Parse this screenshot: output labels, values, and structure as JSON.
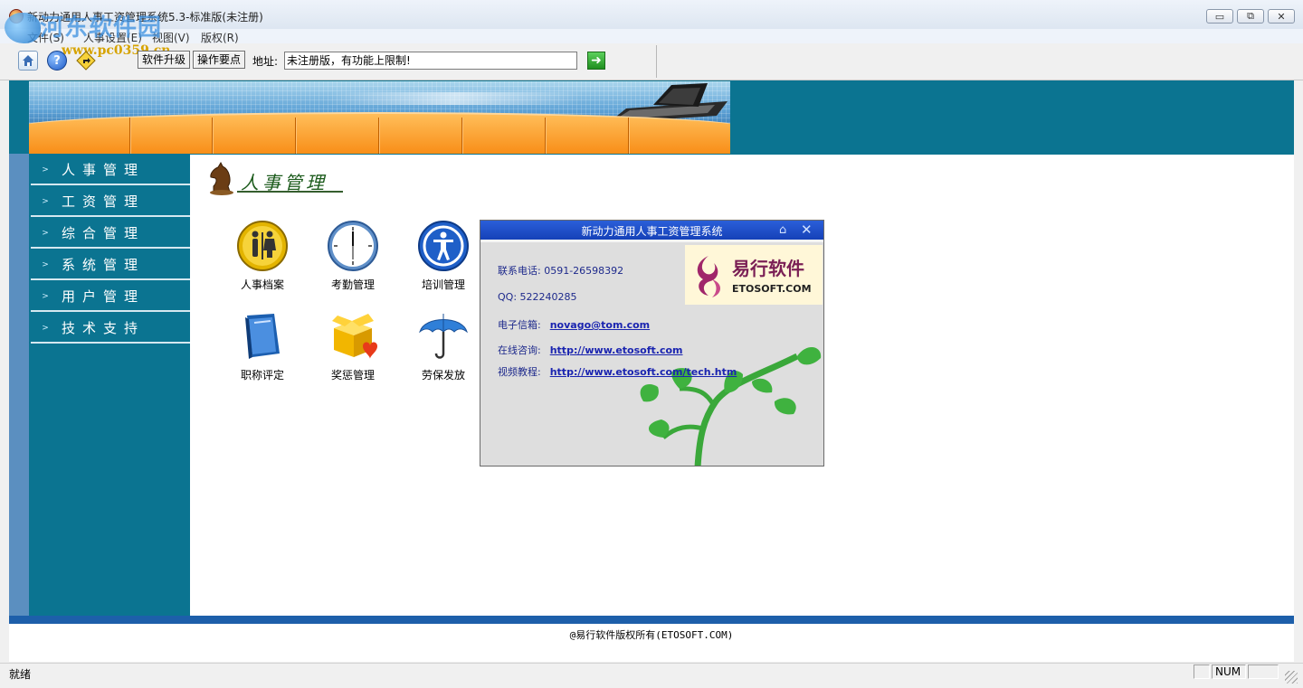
{
  "window": {
    "title": "新动力通用人事工资管理系统5.3-标准版(未注册)",
    "minimize": "▭",
    "maximize": "⧉",
    "close": "✕"
  },
  "watermark": {
    "site": "河东软件园",
    "url": "www.pc0359.cn"
  },
  "menu": [
    "文件(S)",
    "人事设置(E)",
    "视图(V)",
    "版权(R)"
  ],
  "toolbar": {
    "upgrade_label": "软件升级",
    "tips_label": "操作要点",
    "address_label": "地址:",
    "address_value": "未注册版，有功能上限制!",
    "go_icon": "➜"
  },
  "sidebar": {
    "items": [
      {
        "label": "人事管理"
      },
      {
        "label": "工资管理"
      },
      {
        "label": "综合管理"
      },
      {
        "label": "系统管理"
      },
      {
        "label": "用户管理"
      },
      {
        "label": "技术支持"
      }
    ]
  },
  "section": {
    "title": "人事管理"
  },
  "modules": [
    {
      "label": "人事档案",
      "icon": "restroom-icon"
    },
    {
      "label": "考勤管理",
      "icon": "clock-icon"
    },
    {
      "label": "培训管理",
      "icon": "person-icon"
    },
    {
      "label": "职称评定",
      "icon": "book-icon"
    },
    {
      "label": "奖惩管理",
      "icon": "gift-box-icon"
    },
    {
      "label": "劳保发放",
      "icon": "umbrella-icon"
    }
  ],
  "dialog": {
    "title": "新动力通用人事工资管理系统",
    "phone_label": "联系电话: 0591-26598392",
    "qq_label": "QQ: 522240285",
    "email_label": "电子信箱:",
    "email_value": "novago@tom.com",
    "online_label": "在线咨询:",
    "online_value": "http://www.etosoft.com",
    "video_label": "视频教程:",
    "video_value": "http://www.etosoft.com/tech.htm",
    "logo_cn": "易行软件",
    "logo_en": "ETOSOFT.COM"
  },
  "footer": {
    "copyright": "@易行软件版权所有(ETOSOFT.COM)"
  },
  "statusbar": {
    "text": "就绪",
    "num": "NUM"
  },
  "colors": {
    "frame": "#0b7491",
    "sidebar": "#0b7491",
    "banner_orange": "#f88a12",
    "dialog_title": "#1541b8"
  }
}
